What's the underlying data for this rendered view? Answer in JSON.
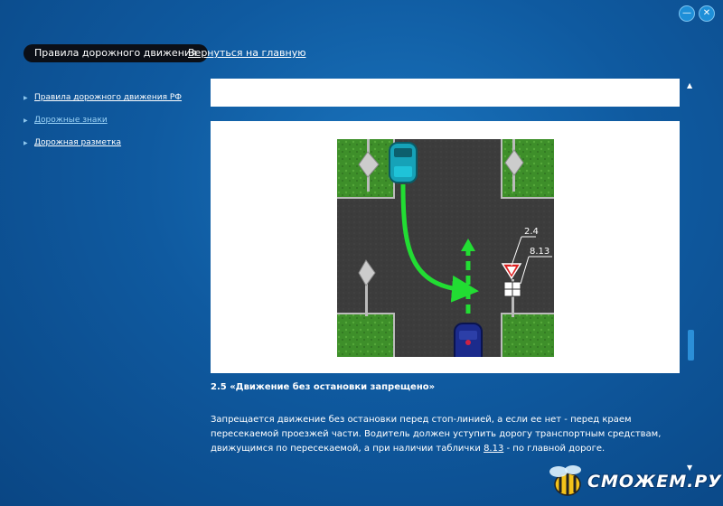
{
  "window": {
    "minimize_icon": "—",
    "close_icon": "✕"
  },
  "header": {
    "title": "Правила дорожного движения",
    "home_link": "Вернуться на главную"
  },
  "sidebar": {
    "items": [
      {
        "label": "Правила дорожного движения РФ",
        "active": false
      },
      {
        "label": "Дорожные знаки",
        "active": true
      },
      {
        "label": "Дорожная разметка",
        "active": false
      }
    ]
  },
  "figure": {
    "sign_label_top": "2.4",
    "sign_label_bottom": "8.13"
  },
  "section": {
    "title": "2.5 «Движение без остановки запрещено»",
    "text_before": "Запрещается движение без остановки перед стоп-линией, а если ее нет - перед краем пересекаемой проезжей части. Водитель должен уступить дорогу транспортным средствам, движущимся по пересекаемой, а при наличии таблички ",
    "text_link": "8.13",
    "text_after": " - по главной дороге."
  },
  "watermark": {
    "text": "СМОЖЕМ.РУ"
  },
  "colors": {
    "background": "#0f5aa0",
    "accent": "#2b8fd8",
    "path_green": "#22dd33"
  }
}
